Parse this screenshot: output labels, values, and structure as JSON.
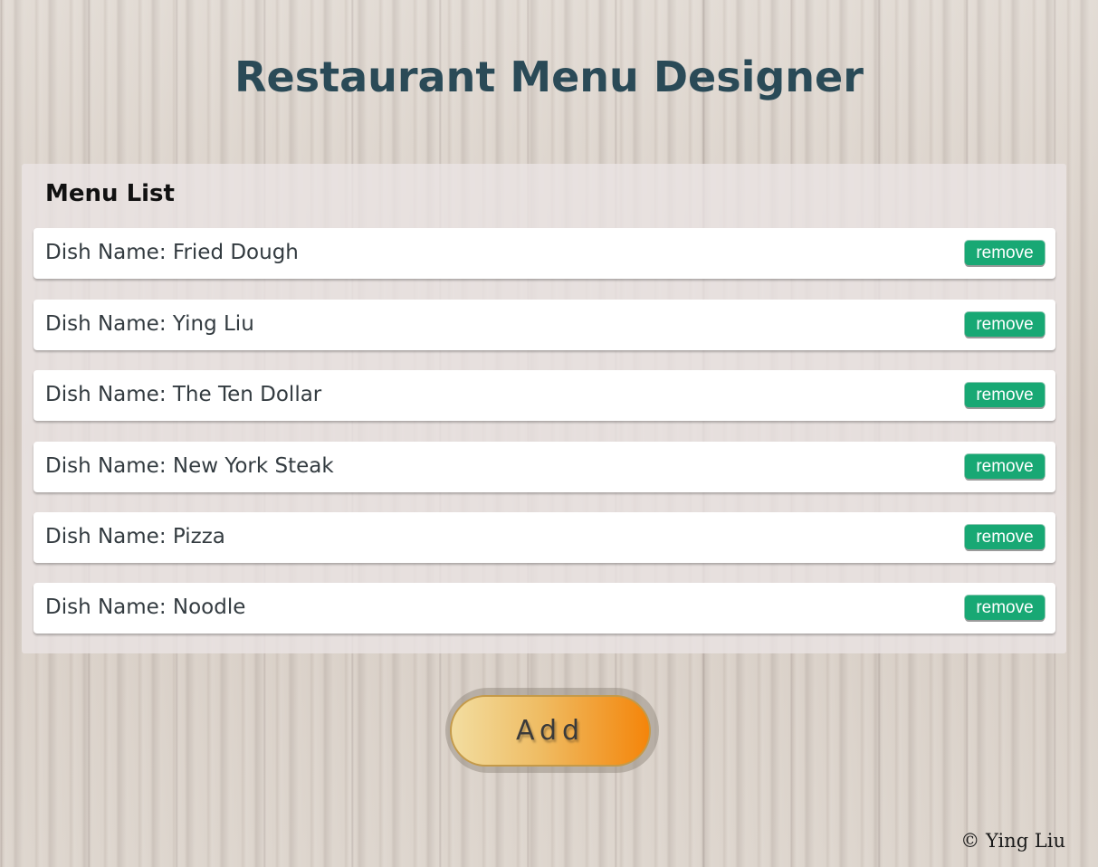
{
  "header": {
    "title": "Restaurant Menu Designer"
  },
  "menu": {
    "heading": "Menu List",
    "dish_prefix": "Dish Name: ",
    "remove_label": "remove",
    "items": [
      {
        "name": "Fried Dough",
        "label": "Dish Name: Fried Dough"
      },
      {
        "name": "Ying Liu",
        "label": "Dish Name: Ying Liu"
      },
      {
        "name": "The Ten Dollar",
        "label": "Dish Name: The Ten Dollar"
      },
      {
        "name": "New York Steak",
        "label": "Dish Name: New York Steak"
      },
      {
        "name": "Pizza",
        "label": "Dish Name: Pizza"
      },
      {
        "name": "Noodle",
        "label": "Dish Name: Noodle"
      }
    ]
  },
  "actions": {
    "add_label": "Add"
  },
  "footer": {
    "copyright": "© Ying Liu"
  },
  "colors": {
    "title": "#2a4a57",
    "remove_button": "#18a874",
    "add_gradient_start": "#f2dda0",
    "add_gradient_end": "#f4850a"
  }
}
